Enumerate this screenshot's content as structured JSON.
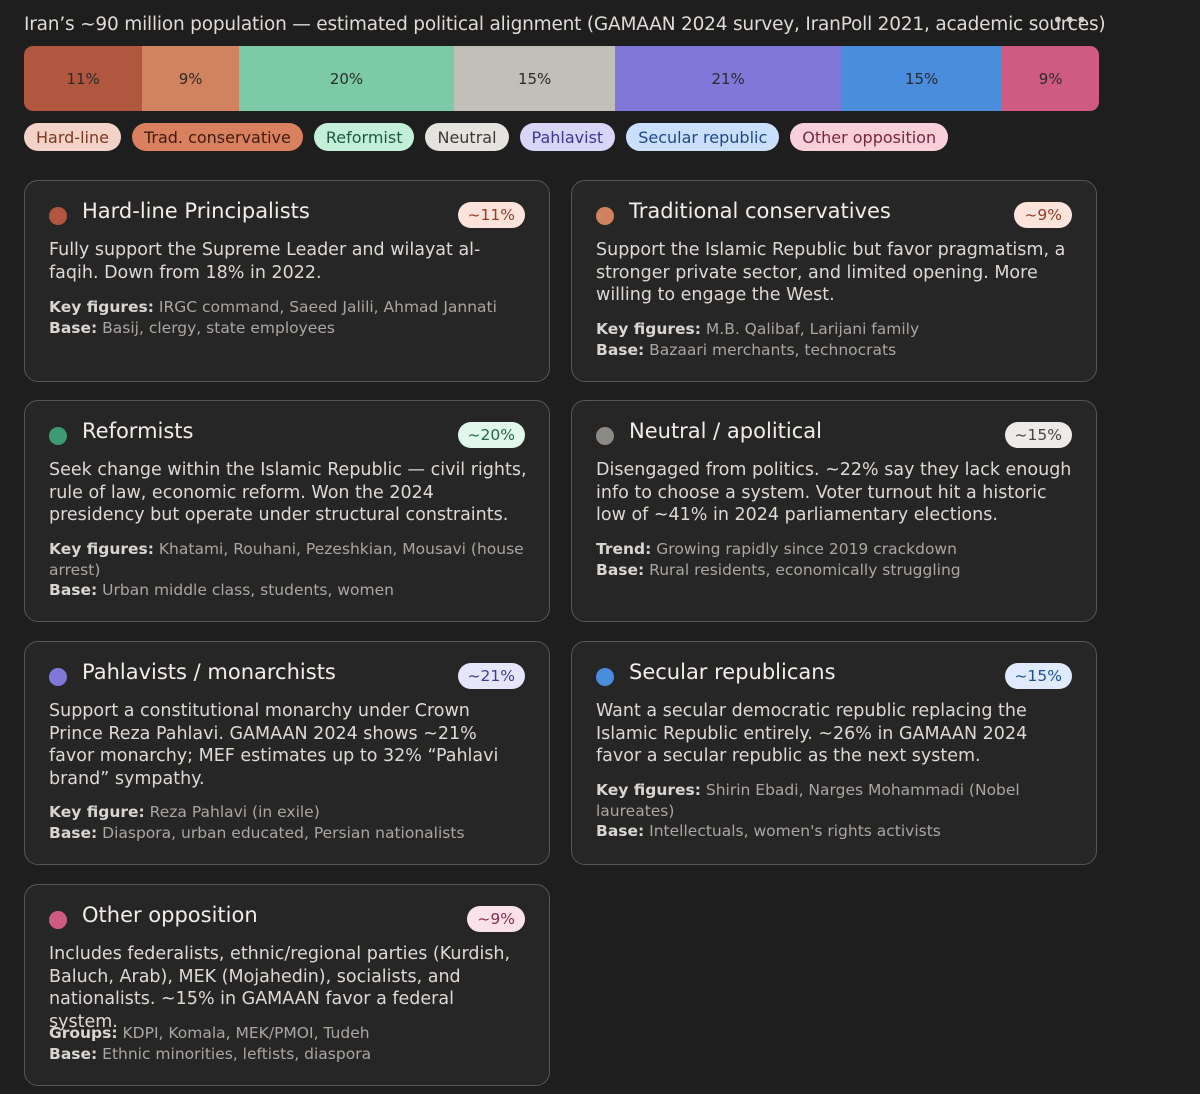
{
  "title": "Iran’s ~90 million population — estimated political alignment (GAMAAN 2024 survey, IranPoll 2021, academic sources)",
  "more_icon": "more-horizontal-icon",
  "chart_data": {
    "type": "bar",
    "stacked": true,
    "orientation": "horizontal",
    "unit": "%",
    "series": [
      {
        "name": "Hard-line",
        "value": 11,
        "label": "11%",
        "color": "#b1573f"
      },
      {
        "name": "Trad. conservative",
        "value": 9,
        "label": "9%",
        "color": "#d1835f"
      },
      {
        "name": "Reformist",
        "value": 20,
        "label": "20%",
        "color": "#7dcba6"
      },
      {
        "name": "Neutral",
        "value": 15,
        "label": "15%",
        "color": "#c1bfb8"
      },
      {
        "name": "Pahlavist",
        "value": 21,
        "label": "21%",
        "color": "#7f78d8"
      },
      {
        "name": "Secular republic",
        "value": 15,
        "label": "15%",
        "color": "#4a8ddc"
      },
      {
        "name": "Other opposition",
        "value": 9,
        "label": "9%",
        "color": "#cf5b83"
      }
    ]
  },
  "legend": [
    {
      "label": "Hard-line",
      "bg": "#f3d3c8",
      "fg": "#7d3621"
    },
    {
      "label": "Trad. conservative",
      "bg": "#d9805f",
      "fg": "#3e1a0e"
    },
    {
      "label": "Reformist",
      "bg": "#c3efd9",
      "fg": "#1f5a40"
    },
    {
      "label": "Neutral",
      "bg": "#e5e3dd",
      "fg": "#3a3935"
    },
    {
      "label": "Pahlavist",
      "bg": "#d8d5f7",
      "fg": "#3d3791"
    },
    {
      "label": "Secular republic",
      "bg": "#cadfff",
      "fg": "#1d4a87"
    },
    {
      "label": "Other opposition",
      "bg": "#f7d0dc",
      "fg": "#7a2441"
    }
  ],
  "cards": [
    {
      "name": "Hard-line Principalists",
      "pct": "~11%",
      "dot": "#b1573f",
      "pct_bg": "#fce4dc",
      "pct_fg": "#9a3b22",
      "desc": "Fully support the Supreme Leader and wilayat al-faqih. Down from 18% in 2022.",
      "meta1_label": "Key figures:",
      "meta1_value": "IRGC command, Saeed Jalili, Ahmad Jannati",
      "meta2_label": "Base:",
      "meta2_value": "Basij, clergy, state employees"
    },
    {
      "name": "Traditional conservatives",
      "pct": "~9%",
      "dot": "#d1835f",
      "pct_bg": "#fce4dc",
      "pct_fg": "#9a3b22",
      "desc": "Support the Islamic Republic but favor pragmatism, a stronger private sector, and limited opening. More willing to engage the West.",
      "meta1_label": "Key figures:",
      "meta1_value": "M.B. Qalibaf, Larijani family",
      "meta2_label": "Base:",
      "meta2_value": "Bazaari merchants, technocrats"
    },
    {
      "name": "Reformists",
      "pct": "~20%",
      "dot": "#3f9a72",
      "pct_bg": "#e1f7ec",
      "pct_fg": "#21694a",
      "desc": "Seek change within the Islamic Republic — civil rights, rule of law, economic reform. Won the 2024 presidency but operate under structural constraints.",
      "meta1_label": "Key figures:",
      "meta1_value": "Khatami, Rouhani, Pezeshkian, Mousavi (house arrest)",
      "meta2_label": "Base:",
      "meta2_value": "Urban middle class, students, women"
    },
    {
      "name": "Neutral / apolitical",
      "pct": "~15%",
      "dot": "#8c8a85",
      "pct_bg": "#ecebe7",
      "pct_fg": "#45443f",
      "desc": "Disengaged from politics. ~22% say they lack enough info to choose a system. Voter turnout hit a historic low of ~41% in 2024 parliamentary elections.",
      "meta1_label": "Trend:",
      "meta1_value": "Growing rapidly since 2019 crackdown",
      "meta2_label": "Base:",
      "meta2_value": "Rural residents, economically struggling"
    },
    {
      "name": "Pahlavists / monarchists",
      "pct": "~21%",
      "dot": "#7f78d8",
      "pct_bg": "#e7e5fb",
      "pct_fg": "#3f3a96",
      "desc": "Support a constitutional monarchy under Crown Prince Reza Pahlavi. GAMAAN 2024 shows ~21% favor monarchy; MEF estimates up to 32% “Pahlavi brand” sympathy.",
      "meta1_label": "Key figure:",
      "meta1_value": "Reza Pahlavi (in exile)",
      "meta2_label": "Base:",
      "meta2_value": "Diaspora, urban educated, Persian nationalists"
    },
    {
      "name": "Secular republicans",
      "pct": "~15%",
      "dot": "#4a8ddc",
      "pct_bg": "#dfeaff",
      "pct_fg": "#1f4f92",
      "desc": "Want a secular democratic republic replacing the Islamic Republic entirely. ~26% in GAMAAN 2024 favor a secular republic as the next system.",
      "meta1_label": "Key figures:",
      "meta1_value": "Shirin Ebadi, Narges Mohammadi (Nobel laureates)",
      "meta2_label": "Base:",
      "meta2_value": "Intellectuals, women's rights activists"
    },
    {
      "name": "Other opposition",
      "pct": "~9%",
      "dot": "#cf5b83",
      "pct_bg": "#fbe1ea",
      "pct_fg": "#8a2a4b",
      "desc": "Includes federalists, ethnic/regional parties (Kurdish, Baluch, Arab), MEK (Mojahedin), socialists, and nationalists. ~15% in GAMAAN favor a federal system.",
      "meta1_label": "Groups:",
      "meta1_value": "KDPI, Komala, MEK/PMOI, Tudeh",
      "meta2_label": "Base:",
      "meta2_value": "Ethnic minorities, leftists, diaspora"
    }
  ]
}
